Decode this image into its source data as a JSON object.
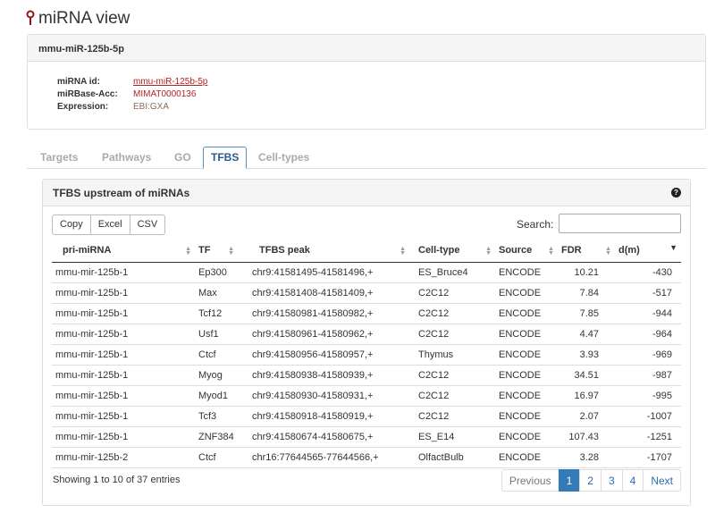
{
  "page": {
    "title": "miRNA view"
  },
  "info": {
    "header": "mmu-miR-125b-5p",
    "rows": [
      {
        "label": "miRNA id:",
        "value": "mmu-miR-125b-5p"
      },
      {
        "label": "miRBase-Acc:",
        "value": "MIMAT0000136"
      },
      {
        "label": "Expression:",
        "value": "EBI:GXA"
      }
    ]
  },
  "tabs": [
    {
      "label": "Targets",
      "active": false
    },
    {
      "label": "Pathways",
      "active": false
    },
    {
      "label": "GO",
      "active": false
    },
    {
      "label": "TFBS",
      "active": true
    },
    {
      "label": "Cell-types",
      "active": false
    }
  ],
  "tfbs": {
    "title": "TFBS upstream of miRNAs",
    "help": "?",
    "buttons": [
      "Copy",
      "Excel",
      "CSV"
    ],
    "search_label": "Search:",
    "search_value": "",
    "columns": [
      "pri-miRNA",
      "TF",
      "TFBS peak",
      "Cell-type",
      "Source",
      "FDR",
      "d(m)"
    ],
    "sorted_column": "d(m)",
    "sort_direction": "descending",
    "rows": [
      [
        "mmu-mir-125b-1",
        "Ep300",
        "chr9:41581495-41581496,+",
        "ES_Bruce4",
        "ENCODE",
        "10.21",
        "-430"
      ],
      [
        "mmu-mir-125b-1",
        "Max",
        "chr9:41581408-41581409,+",
        "C2C12",
        "ENCODE",
        "7.84",
        "-517"
      ],
      [
        "mmu-mir-125b-1",
        "Tcf12",
        "chr9:41580981-41580982,+",
        "C2C12",
        "ENCODE",
        "7.85",
        "-944"
      ],
      [
        "mmu-mir-125b-1",
        "Usf1",
        "chr9:41580961-41580962,+",
        "C2C12",
        "ENCODE",
        "4.47",
        "-964"
      ],
      [
        "mmu-mir-125b-1",
        "Ctcf",
        "chr9:41580956-41580957,+",
        "Thymus",
        "ENCODE",
        "3.93",
        "-969"
      ],
      [
        "mmu-mir-125b-1",
        "Myog",
        "chr9:41580938-41580939,+",
        "C2C12",
        "ENCODE",
        "34.51",
        "-987"
      ],
      [
        "mmu-mir-125b-1",
        "Myod1",
        "chr9:41580930-41580931,+",
        "C2C12",
        "ENCODE",
        "16.97",
        "-995"
      ],
      [
        "mmu-mir-125b-1",
        "Tcf3",
        "chr9:41580918-41580919,+",
        "C2C12",
        "ENCODE",
        "2.07",
        "-1007"
      ],
      [
        "mmu-mir-125b-1",
        "ZNF384",
        "chr9:41580674-41580675,+",
        "ES_E14",
        "ENCODE",
        "107.43",
        "-1251"
      ],
      [
        "mmu-mir-125b-2",
        "Ctcf",
        "chr16:77644565-77644566,+",
        "OlfactBulb",
        "ENCODE",
        "3.28",
        "-1707"
      ]
    ],
    "footer_info": "Showing 1 to 10 of 37 entries",
    "pagination": [
      "Previous",
      "1",
      "2",
      "3",
      "4",
      "Next"
    ],
    "current_page": "1"
  },
  "colors": {
    "mirna_link": "#a52a2a",
    "tf_link": "#2a5a8a",
    "active_page": "#337ab7"
  }
}
